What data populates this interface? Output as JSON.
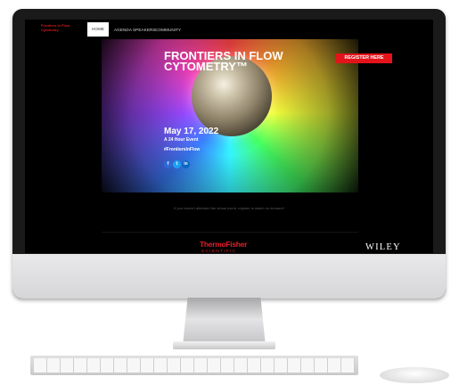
{
  "nav": {
    "logo_text": "Frontiers in Flow Cytometry",
    "items": [
      "HOME",
      "AGENDA",
      "SPEAKERS",
      "COMMUNITY"
    ]
  },
  "hero": {
    "title": "FRONTIERS IN FLOW CYTOMETRY™",
    "date": "May 17, 2022",
    "subtitle": "A 24 Hour Event",
    "hashtag": "#FrontiersInFlow",
    "register_label": "REGISTER HERE",
    "social_icons": [
      "facebook-icon",
      "twitter-icon",
      "linkedin-icon"
    ]
  },
  "notice": "If you haven't attended the virtual event, register to watch on demand!",
  "sponsors": {
    "thermo_name": "ThermoFisher",
    "thermo_sub": "SCIENTIFIC",
    "wiley": "WILEY"
  },
  "colors": {
    "accent_red": "#e3131b",
    "screen_background": "#000000",
    "nav_active_bg": "#ffffff"
  }
}
